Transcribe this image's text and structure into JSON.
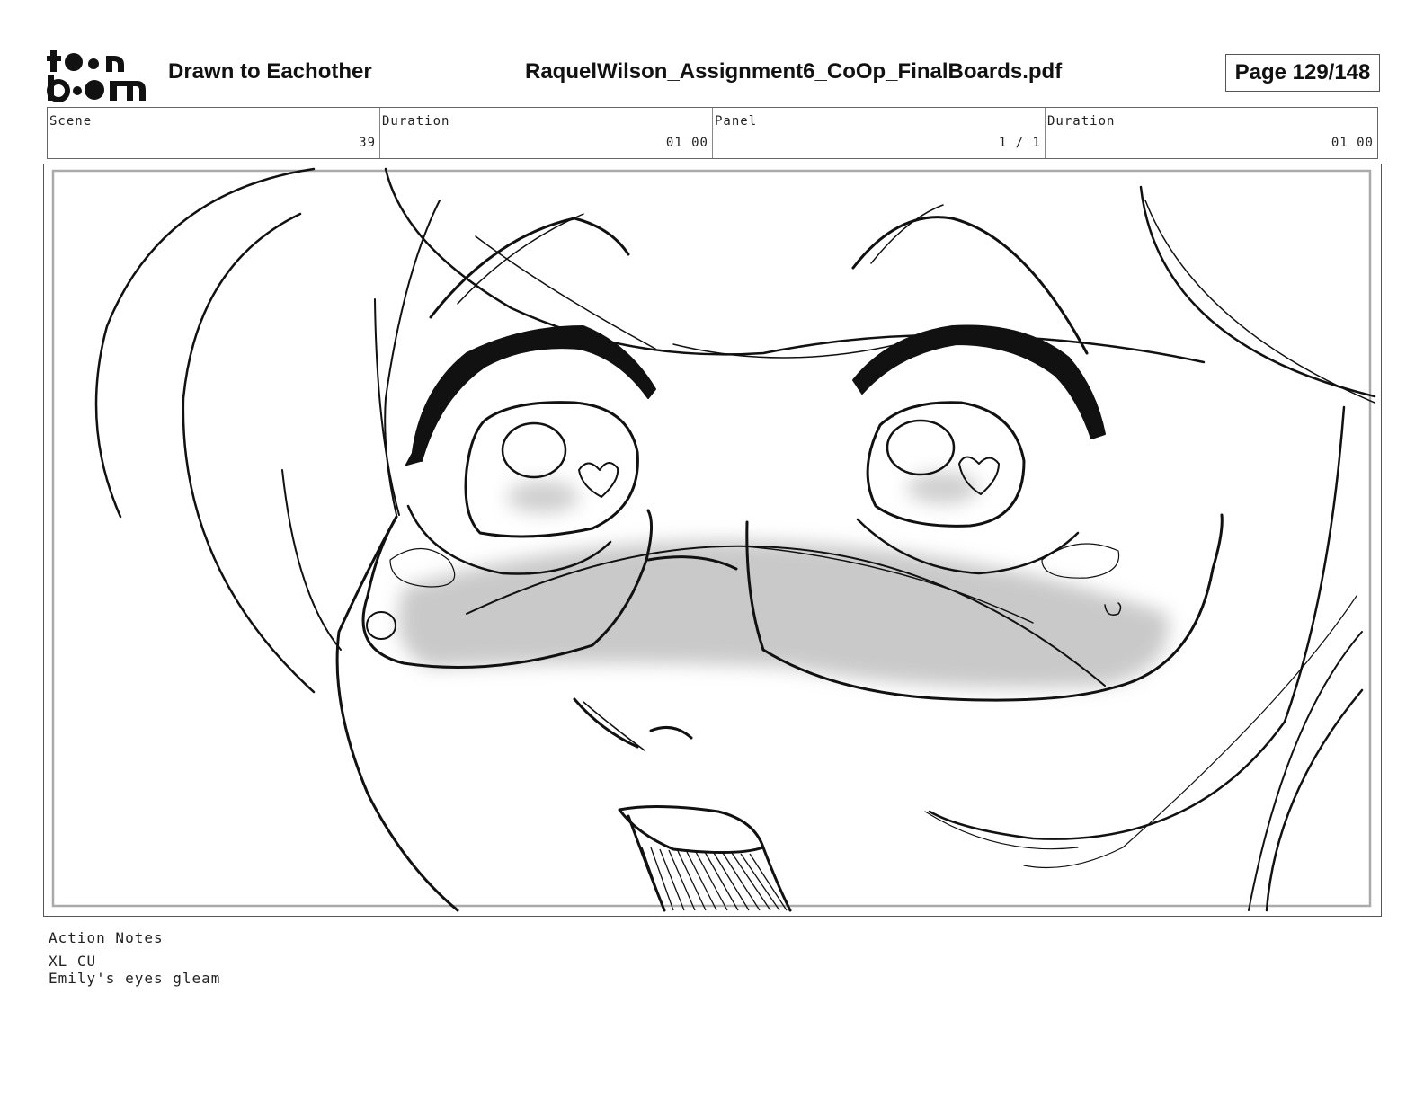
{
  "header": {
    "logo_text_top": "toon",
    "logo_text_bottom": "boom",
    "project_title": "Drawn to Eachother",
    "file_name": "RaquelWilson_Assignment6_CoOp_FinalBoards.pdf",
    "page_label": "Page 129/148"
  },
  "info": {
    "scene_label": "Scene",
    "scene_value": "39",
    "duration_label": "Duration",
    "duration_value": "01 00",
    "panel_label": "Panel",
    "panel_value": "1 / 1",
    "panel_duration_label": "Duration",
    "panel_duration_value": "01 00"
  },
  "panel": {
    "safe_frame_color": "#aaaaaa",
    "blush_color": "#b8b8b8",
    "line_color": "#111111"
  },
  "notes": {
    "label": "Action Notes",
    "lines": [
      "XL CU",
      "Emily's eyes gleam"
    ]
  }
}
